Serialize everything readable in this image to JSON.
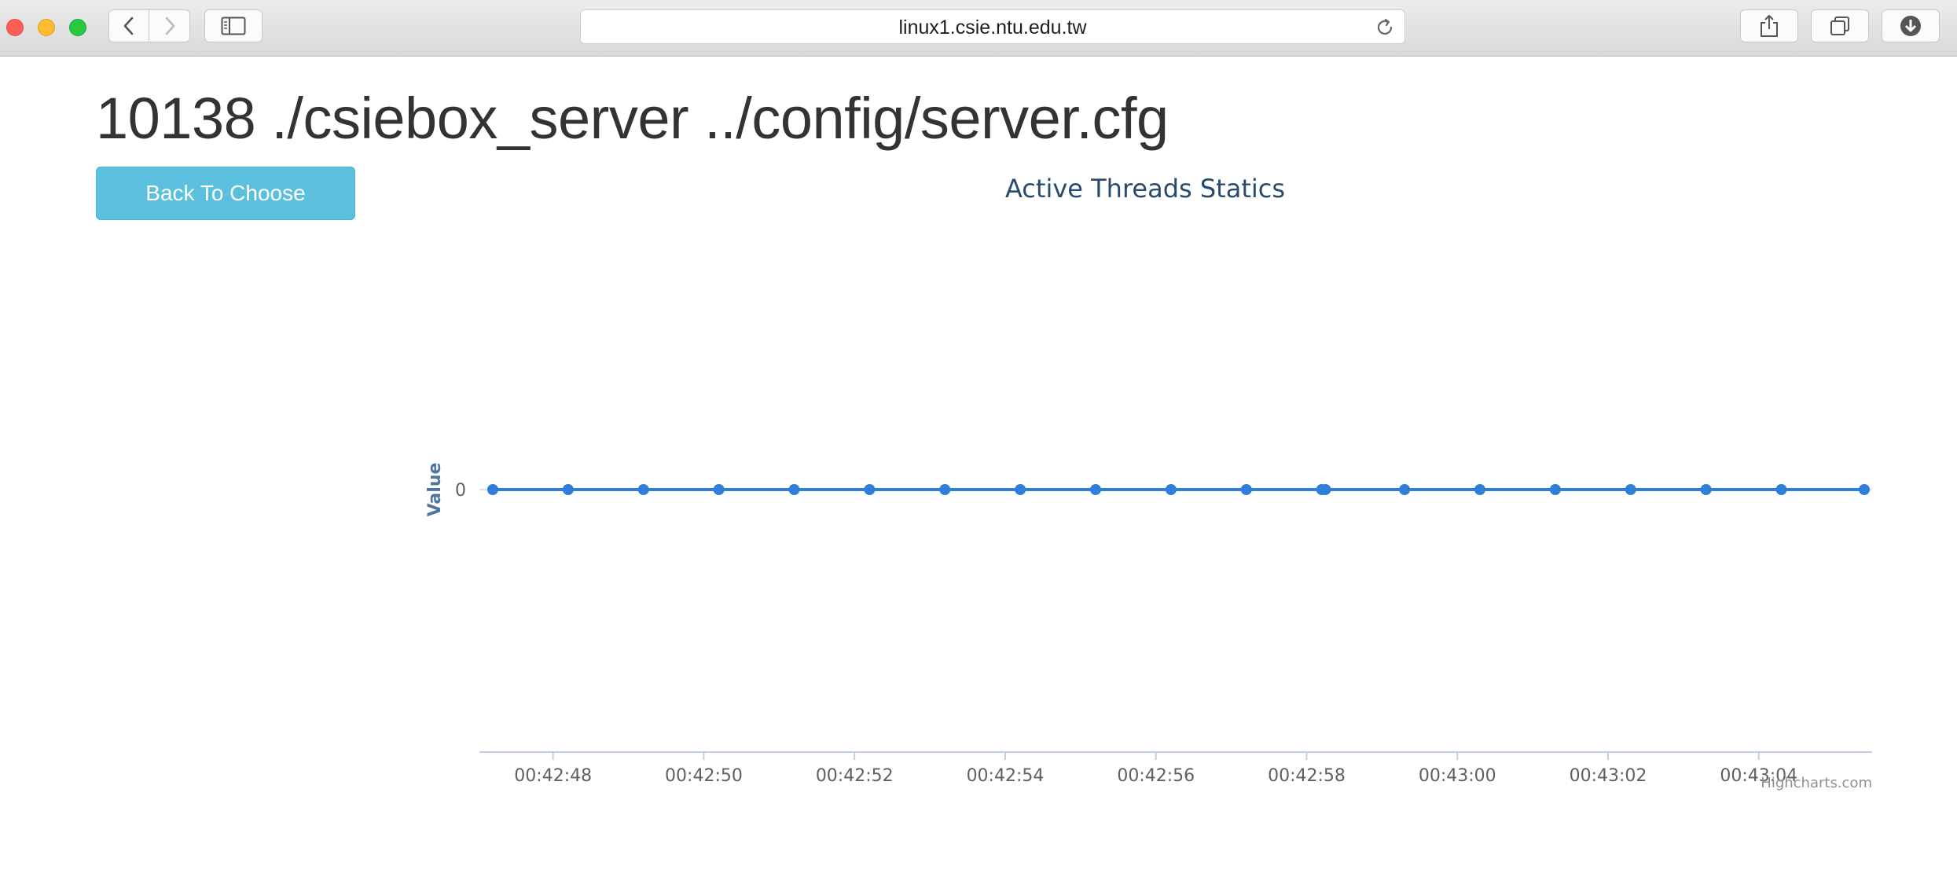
{
  "browser": {
    "url": "linux1.csie.ntu.edu.tw",
    "icons": {
      "back": "chevron-left-icon",
      "forward": "chevron-right-icon",
      "sidebar": "sidebar-icon",
      "reload": "reload-icon",
      "share": "share-icon",
      "tabs": "tabs-icon",
      "download": "download-icon"
    }
  },
  "page": {
    "title": "10138 ./csiebox_server ../config/server.cfg",
    "back_button_label": "Back To Choose"
  },
  "colors": {
    "accent_button": "#5bc0de",
    "series_line": "#2f7ed8",
    "chart_title": "#274b6d"
  },
  "chart_data": {
    "type": "line",
    "title": "Active Threads Statics",
    "xlabel": "",
    "ylabel": "Value",
    "x_type": "datetime",
    "x": [
      "00:42:47.2",
      "00:42:48.2",
      "00:42:49.2",
      "00:42:50.2",
      "00:42:51.2",
      "00:42:52.2",
      "00:42:53.2",
      "00:42:54.2",
      "00:42:55.2",
      "00:42:56.2",
      "00:42:57.2",
      "00:42:58.2",
      "00:42:58.25",
      "00:42:59.3",
      "00:43:00.3",
      "00:43:01.3",
      "00:43:02.3",
      "00:43:03.3",
      "00:43:04.3",
      "00:43:05.4"
    ],
    "values": [
      0,
      0,
      0,
      0,
      0,
      0,
      0,
      0,
      0,
      0,
      0,
      0,
      0,
      0,
      0,
      0,
      0,
      0,
      0,
      0
    ],
    "x_ticks": [
      "00:42:48",
      "00:42:50",
      "00:42:52",
      "00:42:54",
      "00:42:56",
      "00:42:58",
      "00:43:00",
      "00:43:02",
      "00:43:04"
    ],
    "y_ticks": [
      "0"
    ],
    "legend": false,
    "grid": false,
    "credits": "Highcharts.com"
  }
}
